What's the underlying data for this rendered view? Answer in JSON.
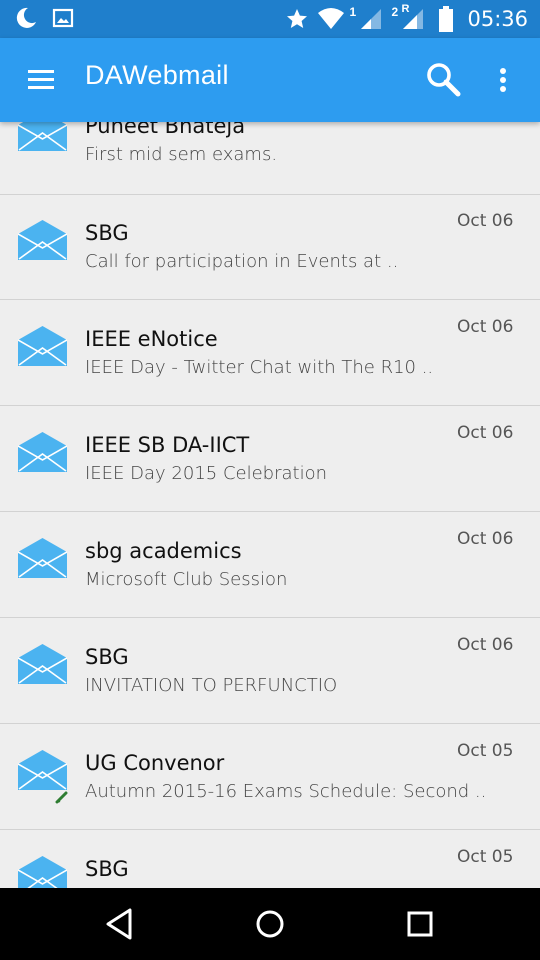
{
  "status_bar": {
    "time": "05:36",
    "sim1_label": "1",
    "sim2_label": "2",
    "sim2_roaming": "R",
    "icons": [
      "moon-icon",
      "image-icon",
      "star-icon",
      "wifi-icon",
      "signal-icon",
      "battery-icon"
    ]
  },
  "toolbar": {
    "title": "DAWebmail",
    "icons": [
      "menu-icon",
      "search-icon",
      "more-vert-icon"
    ]
  },
  "colors": {
    "toolbar": "#2d9cf0",
    "status_bar": "#1f7fcc",
    "envelope": "#4bb3f0",
    "background": "#eeeeee"
  },
  "emails": [
    {
      "sender": "Puneet Bhateja",
      "subject": "First mid sem exams.",
      "date": ""
    },
    {
      "sender": "SBG",
      "subject": "Call for participation in Events at ..",
      "date": "Oct 06"
    },
    {
      "sender": "IEEE eNotice",
      "subject": "IEEE Day - Twitter Chat with The R10 ..",
      "date": "Oct 06"
    },
    {
      "sender": "IEEE SB DA-IICT",
      "subject": "IEEE Day 2015 Celebration",
      "date": "Oct 06"
    },
    {
      "sender": "sbg academics",
      "subject": "Microsoft Club Session",
      "date": "Oct 06"
    },
    {
      "sender": "SBG",
      "subject": "INVITATION TO PERFUNCTIO",
      "date": "Oct 06"
    },
    {
      "sender": "UG Convenor",
      "subject": "Autumn 2015-16 Exams Schedule: Second ..",
      "date": "Oct 05",
      "has_attachment": true
    },
    {
      "sender": "SBG",
      "subject": "",
      "date": "Oct 05"
    }
  ],
  "nav_bar": {
    "icons": [
      "back-icon",
      "home-icon",
      "recents-icon"
    ]
  }
}
